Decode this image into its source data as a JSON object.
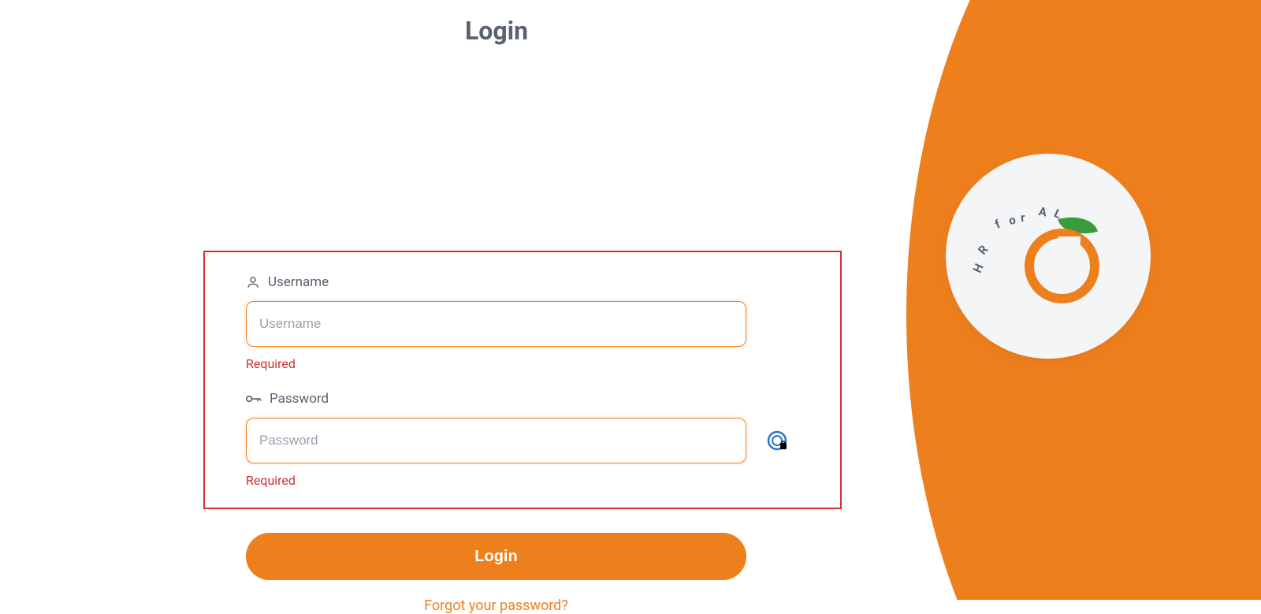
{
  "page_title": "Login",
  "logo": {
    "text": "HR for ALL"
  },
  "form": {
    "username": {
      "label": "Username",
      "placeholder": "Username",
      "value": "",
      "error": "Required"
    },
    "password": {
      "label": "Password",
      "placeholder": "Password",
      "value": "",
      "error": "Required"
    }
  },
  "buttons": {
    "login": "Login"
  },
  "links": {
    "forgot_password": "Forgot your password?"
  },
  "colors": {
    "accent": "#ee7f1d",
    "error": "#d32f2f",
    "text_muted": "#5a6270"
  }
}
